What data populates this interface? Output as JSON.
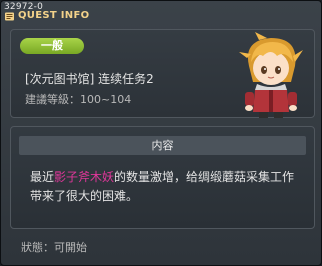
{
  "window": {
    "id_text": "32972-0",
    "title": "QUEST INFO"
  },
  "quest": {
    "badge": "一般",
    "name": "[次元图书馆] 连续任务2",
    "level_label": "建議等級",
    "level_range": "100~104"
  },
  "content": {
    "header": "内容",
    "desc_before": "最近",
    "desc_highlight": "影子斧木妖",
    "desc_after_line1": "的数量激增，给绸缎蘑菇采集工作",
    "desc_line2": "带来了很大的困难。"
  },
  "status": {
    "label": "狀態",
    "value": "可開始"
  },
  "colors": {
    "title": "#f3d28a",
    "badge": "#8fc033",
    "highlight": "#e0379a"
  },
  "icons": {
    "title_icon": "quest-book-icon",
    "npc_portrait": "npc-avatar"
  }
}
